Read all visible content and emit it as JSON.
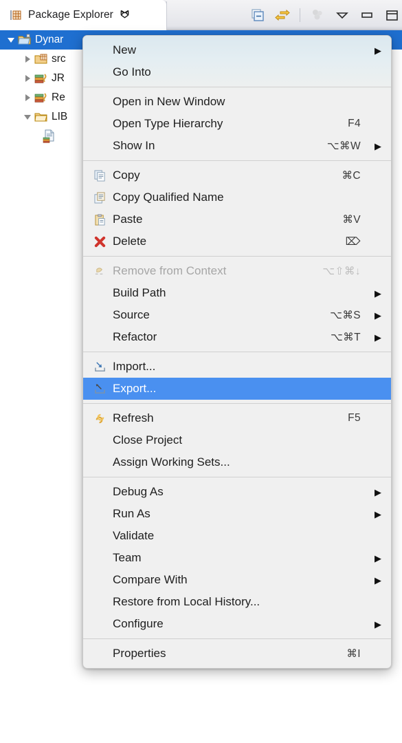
{
  "view": {
    "tab_title": "Package Explorer",
    "tab_icon": "package-explorer-icon",
    "close_glyph": "✖",
    "toolbar": [
      {
        "name": "collapse-all-icon",
        "title": "Collapse All"
      },
      {
        "name": "link-with-editor-icon",
        "title": "Link with Editor"
      },
      {
        "name": "focus-on-active-task-icon",
        "title": "Focus on Active Task"
      },
      {
        "name": "view-menu-icon",
        "title": "View Menu"
      },
      {
        "name": "minimize-icon",
        "title": "Minimize"
      },
      {
        "name": "maximize-icon",
        "title": "Maximize"
      }
    ]
  },
  "tree": {
    "rows": [
      {
        "label": "Dynar",
        "icon": "dynamic-web-project-icon",
        "twisty": "down",
        "indent": 8,
        "selected": true
      },
      {
        "label": "src",
        "icon": "source-folder-icon",
        "twisty": "right",
        "indent": 32,
        "selected": false
      },
      {
        "label": "JR",
        "icon": "jre-library-icon",
        "twisty": "right",
        "indent": 32,
        "selected": false
      },
      {
        "label": "Re",
        "icon": "jre-library-icon",
        "twisty": "right",
        "indent": 32,
        "selected": false
      },
      {
        "label": "LIB",
        "icon": "folder-icon",
        "twisty": "down",
        "indent": 32,
        "selected": false
      },
      {
        "label": "",
        "icon": "jar-file-icon",
        "twisty": "none",
        "indent": 62,
        "selected": false
      }
    ]
  },
  "context_menu": {
    "highlight_color": "#4a90f0",
    "groups": [
      {
        "items": [
          {
            "label": "New",
            "icon": null,
            "accel": "",
            "submenu": true,
            "disabled": false,
            "highlighted": false
          },
          {
            "label": "Go Into",
            "icon": null,
            "accel": "",
            "submenu": false,
            "disabled": false,
            "highlighted": false
          }
        ]
      },
      {
        "items": [
          {
            "label": "Open in New Window",
            "icon": null,
            "accel": "",
            "submenu": false,
            "disabled": false,
            "highlighted": false
          },
          {
            "label": "Open Type Hierarchy",
            "icon": null,
            "accel": "F4",
            "submenu": false,
            "disabled": false,
            "highlighted": false
          },
          {
            "label": "Show In",
            "icon": null,
            "accel": "⌥⌘W",
            "submenu": true,
            "disabled": false,
            "highlighted": false
          }
        ]
      },
      {
        "items": [
          {
            "label": "Copy",
            "icon": "copy-icon",
            "accel": "⌘C",
            "submenu": false,
            "disabled": false,
            "highlighted": false
          },
          {
            "label": "Copy Qualified Name",
            "icon": "copy-qualified-name-icon",
            "accel": "",
            "submenu": false,
            "disabled": false,
            "highlighted": false
          },
          {
            "label": "Paste",
            "icon": "paste-icon",
            "accel": "⌘V",
            "submenu": false,
            "disabled": false,
            "highlighted": false
          },
          {
            "label": "Delete",
            "icon": "delete-icon",
            "accel": "⌦",
            "submenu": false,
            "disabled": false,
            "highlighted": false
          }
        ]
      },
      {
        "items": [
          {
            "label": "Remove from Context",
            "icon": "remove-from-context-icon",
            "accel": "⌥⇧⌘↓",
            "submenu": false,
            "disabled": true,
            "highlighted": false
          },
          {
            "label": "Build Path",
            "icon": null,
            "accel": "",
            "submenu": true,
            "disabled": false,
            "highlighted": false
          },
          {
            "label": "Source",
            "icon": null,
            "accel": "⌥⌘S",
            "submenu": true,
            "disabled": false,
            "highlighted": false
          },
          {
            "label": "Refactor",
            "icon": null,
            "accel": "⌥⌘T",
            "submenu": true,
            "disabled": false,
            "highlighted": false
          }
        ]
      },
      {
        "items": [
          {
            "label": "Import...",
            "icon": "import-icon",
            "accel": "",
            "submenu": false,
            "disabled": false,
            "highlighted": false
          },
          {
            "label": "Export...",
            "icon": "export-icon",
            "accel": "",
            "submenu": false,
            "disabled": false,
            "highlighted": true
          }
        ]
      },
      {
        "items": [
          {
            "label": "Refresh",
            "icon": "refresh-icon",
            "accel": "F5",
            "submenu": false,
            "disabled": false,
            "highlighted": false
          },
          {
            "label": "Close Project",
            "icon": null,
            "accel": "",
            "submenu": false,
            "disabled": false,
            "highlighted": false
          },
          {
            "label": "Assign Working Sets...",
            "icon": null,
            "accel": "",
            "submenu": false,
            "disabled": false,
            "highlighted": false
          }
        ]
      },
      {
        "items": [
          {
            "label": "Debug As",
            "icon": null,
            "accel": "",
            "submenu": true,
            "disabled": false,
            "highlighted": false
          },
          {
            "label": "Run As",
            "icon": null,
            "accel": "",
            "submenu": true,
            "disabled": false,
            "highlighted": false
          },
          {
            "label": "Validate",
            "icon": null,
            "accel": "",
            "submenu": false,
            "disabled": false,
            "highlighted": false
          },
          {
            "label": "Team",
            "icon": null,
            "accel": "",
            "submenu": true,
            "disabled": false,
            "highlighted": false
          },
          {
            "label": "Compare With",
            "icon": null,
            "accel": "",
            "submenu": true,
            "disabled": false,
            "highlighted": false
          },
          {
            "label": "Restore from Local History...",
            "icon": null,
            "accel": "",
            "submenu": false,
            "disabled": false,
            "highlighted": false
          },
          {
            "label": "Configure",
            "icon": null,
            "accel": "",
            "submenu": true,
            "disabled": false,
            "highlighted": false
          }
        ]
      },
      {
        "items": [
          {
            "label": "Properties",
            "icon": null,
            "accel": "⌘I",
            "submenu": false,
            "disabled": false,
            "highlighted": false
          }
        ]
      }
    ]
  }
}
